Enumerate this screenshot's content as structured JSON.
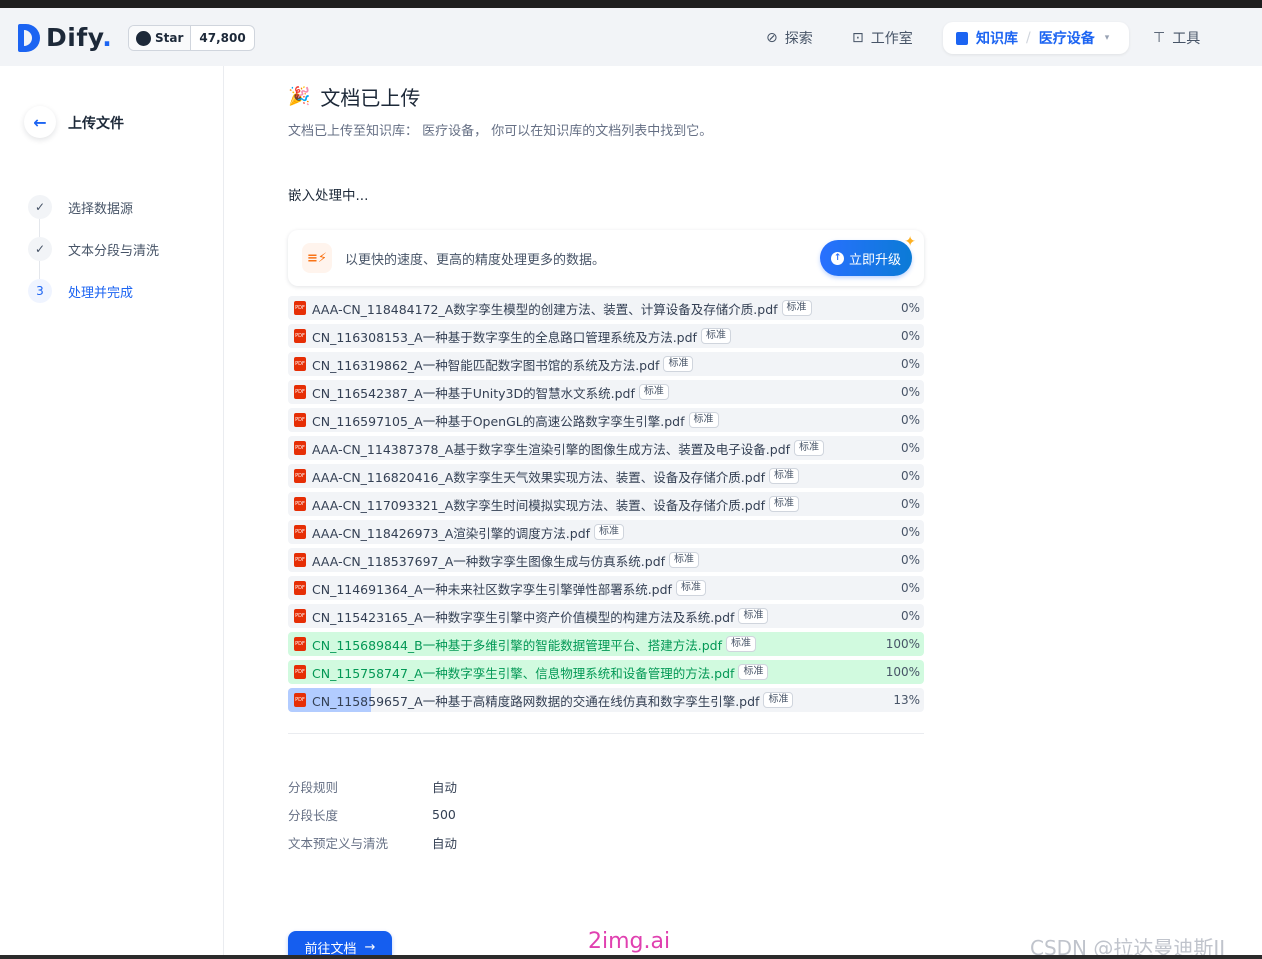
{
  "app": {
    "logo_text": "Dify",
    "logo_dot": "."
  },
  "github": {
    "star_label": "Star",
    "star_count": "47,800"
  },
  "nav": {
    "explore": "探索",
    "studio": "工作室",
    "knowledge": "知识库",
    "dataset": "医疗设备",
    "tools": "工具"
  },
  "sidebar": {
    "title": "上传文件",
    "steps": [
      {
        "label": "选择数据源",
        "marker": "✓",
        "state": "done"
      },
      {
        "label": "文本分段与清洗",
        "marker": "✓",
        "state": "done"
      },
      {
        "label": "处理并完成",
        "marker": "3",
        "state": "active"
      }
    ]
  },
  "main": {
    "title": "文档已上传",
    "subtitle": "文档已上传至知识库： 医疗设备， 你可以在知识库的文档列表中找到它。",
    "embed_status": "嵌入处理中...",
    "upgrade_text": "以更快的速度、更高的精度处理更多的数据。",
    "upgrade_button": "立即升级"
  },
  "files": [
    {
      "name": "AAA-CN_118484172_A数字孪生模型的创建方法、装置、计算设备及存储介质.pdf",
      "badge": "标准",
      "progress": "0%",
      "fill": 0
    },
    {
      "name": "CN_116308153_A一种基于数字孪生的全息路口管理系统及方法.pdf",
      "badge": "标准",
      "progress": "0%",
      "fill": 0
    },
    {
      "name": "CN_116319862_A一种智能匹配数字图书馆的系统及方法.pdf",
      "badge": "标准",
      "progress": "0%",
      "fill": 0
    },
    {
      "name": "CN_116542387_A一种基于Unity3D的智慧水文系统.pdf",
      "badge": "标准",
      "progress": "0%",
      "fill": 0
    },
    {
      "name": "CN_116597105_A一种基于OpenGL的高速公路数字孪生引擎.pdf",
      "badge": "标准",
      "progress": "0%",
      "fill": 0
    },
    {
      "name": "AAA-CN_114387378_A基于数字孪生渲染引擎的图像生成方法、装置及电子设备.pdf",
      "badge": "标准",
      "progress": "0%",
      "fill": 0
    },
    {
      "name": "AAA-CN_116820416_A数字孪生天气效果实现方法、装置、设备及存储介质.pdf",
      "badge": "标准",
      "progress": "0%",
      "fill": 0
    },
    {
      "name": "AAA-CN_117093321_A数字孪生时间模拟实现方法、装置、设备及存储介质.pdf",
      "badge": "标准",
      "progress": "0%",
      "fill": 0
    },
    {
      "name": "AAA-CN_118426973_A渲染引擎的调度方法.pdf",
      "badge": "标准",
      "progress": "0%",
      "fill": 0
    },
    {
      "name": "AAA-CN_118537697_A一种数字孪生图像生成与仿真系统.pdf",
      "badge": "标准",
      "progress": "0%",
      "fill": 0
    },
    {
      "name": "CN_114691364_A一种未来社区数字孪生引擎弹性部署系统.pdf",
      "badge": "标准",
      "progress": "0%",
      "fill": 0
    },
    {
      "name": "CN_115423165_A一种数字孪生引擎中资产价值模型的构建方法及系统.pdf",
      "badge": "标准",
      "progress": "0%",
      "fill": 0
    },
    {
      "name": "CN_115689844_B一种基于多维引擎的智能数据管理平台、搭建方法.pdf",
      "badge": "标准",
      "progress": "100%",
      "fill": 1
    },
    {
      "name": "CN_115758747_A一种数字孪生引擎、信息物理系统和设备管理的方法.pdf",
      "badge": "标准",
      "progress": "100%",
      "fill": 1
    },
    {
      "name": "CN_115859657_A一种基于高精度路网数据的交通在线仿真和数字孪生引擎.pdf",
      "badge": "标准",
      "progress": "13%",
      "fill": 0.13
    }
  ],
  "rules": [
    {
      "key": "分段规则",
      "value": "自动"
    },
    {
      "key": "分段长度",
      "value": "500"
    },
    {
      "key": "文本预定义与清洗",
      "value": "自动"
    }
  ],
  "actions": {
    "go_to_docs": "前往文档"
  },
  "watermarks": {
    "center": "2img.ai",
    "corner": "CSDN @拉达曼迪斯II"
  },
  "colors": {
    "accent": "#1c64f2",
    "success_bg": "#d1fadf",
    "progress_fill": "#b2ccff"
  }
}
